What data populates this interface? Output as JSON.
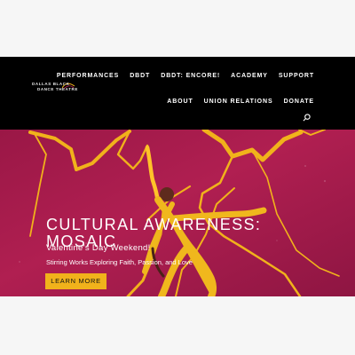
{
  "header": {
    "logo_text_line1": "DALLAS BLACK",
    "logo_text_line2": "DANCE THEATRE",
    "nav_row1": [
      "PERFORMANCES",
      "DBDT",
      "DBDT: ENCORE!",
      "ACADEMY",
      "SUPPORT"
    ],
    "nav_row2": [
      "ABOUT",
      "UNION RELATIONS",
      "DONATE"
    ],
    "search_icon": "search-icon"
  },
  "hero": {
    "title": "CULTURAL AWARENESS: MOSAIC",
    "subtitle": "Valentine’s Day Weekend!",
    "tagline": "Stirring Works Exploring Faith, Passion, and Love",
    "cta_label": "LEARN MORE"
  },
  "colors": {
    "header_bg": "#000000",
    "hero_bg": "#a81c4b",
    "accent_gold": "#f1b21b",
    "dancer_outfit": "#f0b71d"
  }
}
